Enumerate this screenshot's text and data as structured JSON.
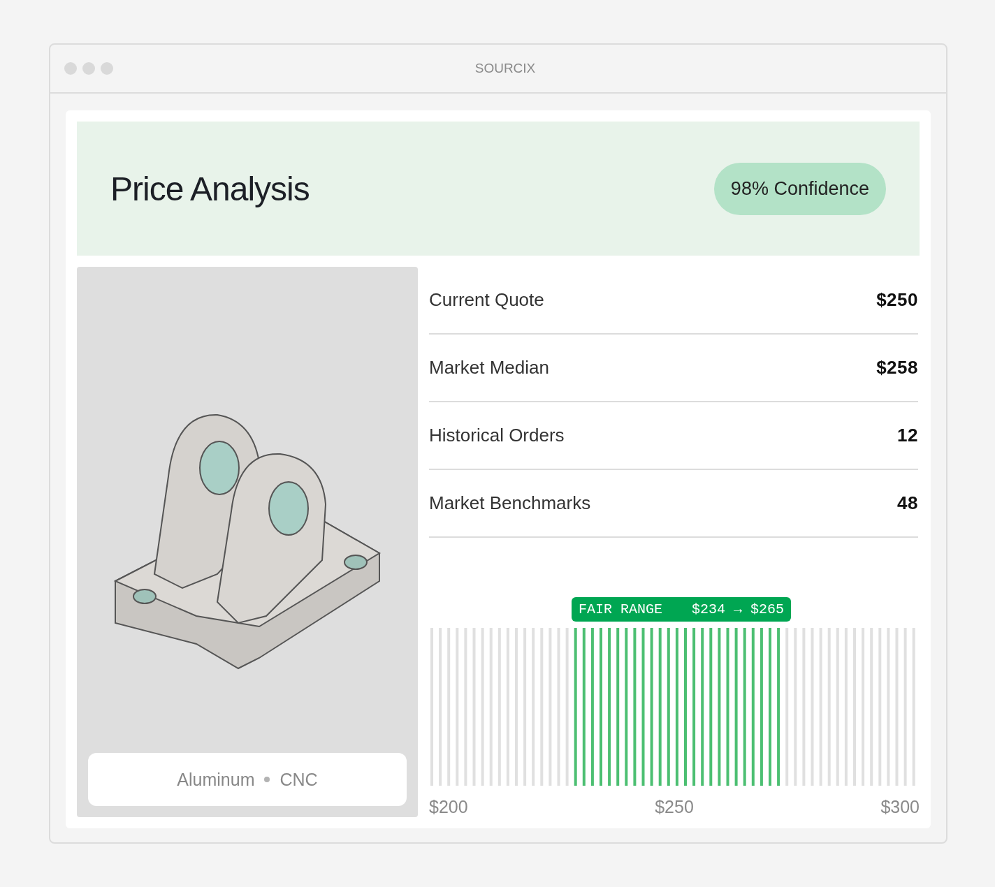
{
  "window": {
    "title": "SOURCIX"
  },
  "header": {
    "title": "Price Analysis",
    "badge": "98% Confidence"
  },
  "part": {
    "material": "Aluminum",
    "process": "CNC"
  },
  "metrics": [
    {
      "label": "Current Quote",
      "value": "$250"
    },
    {
      "label": "Market Median",
      "value": "$258"
    },
    {
      "label": "Historical Orders",
      "value": "12"
    },
    {
      "label": "Market Benchmarks",
      "value": "48"
    }
  ],
  "range": {
    "label": "FAIR RANGE",
    "low": "$234",
    "arrow": "→",
    "high": "$265",
    "axis": [
      "$200",
      "$250",
      "$300"
    ]
  }
}
